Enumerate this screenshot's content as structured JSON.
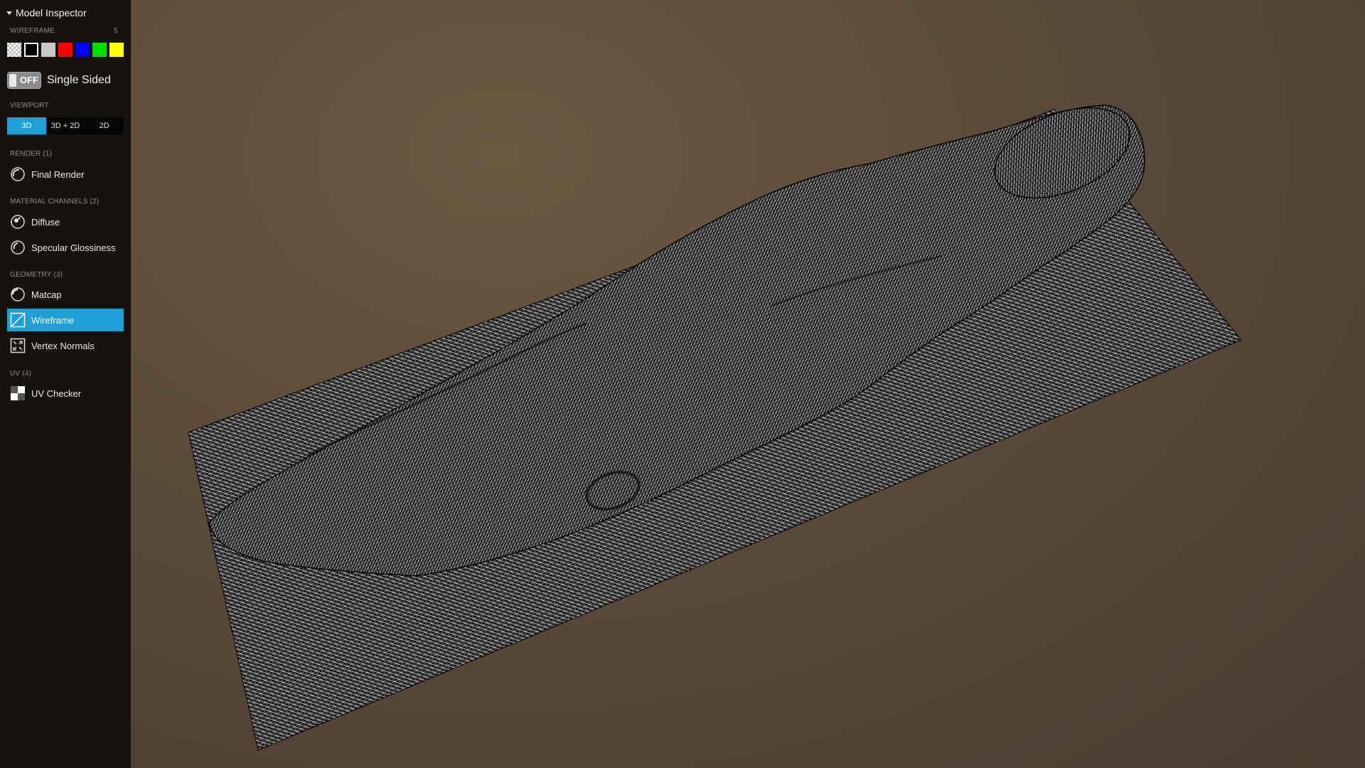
{
  "panel": {
    "title": "Model Inspector",
    "wireframe_label": "WIREFRAME",
    "wireframe_value": "5",
    "swatches": [
      {
        "name": "transparent",
        "color": "checker"
      },
      {
        "name": "black",
        "color": "#000000"
      },
      {
        "name": "gray",
        "color": "#c8c8c8"
      },
      {
        "name": "red",
        "color": "#ff0000"
      },
      {
        "name": "blue",
        "color": "#0000ff"
      },
      {
        "name": "green",
        "color": "#00e000"
      },
      {
        "name": "yellow",
        "color": "#ffff00"
      }
    ],
    "single_sided": {
      "state": "OFF",
      "label": "Single Sided"
    },
    "viewport_label": "VIEWPORT",
    "viewport_options": [
      "3D",
      "3D + 2D",
      "2D"
    ],
    "viewport_selected": "3D",
    "render_label": "RENDER (1)",
    "render_items": [
      "Final Render"
    ],
    "material_label": "MATERIAL CHANNELS (2)",
    "material_items": [
      "Diffuse",
      "Specular Glossiness"
    ],
    "geometry_label": "GEOMETRY (3)",
    "geometry_items": [
      "Matcap",
      "Wireframe",
      "Vertex Normals"
    ],
    "geometry_selected": "Wireframe",
    "uv_label": "UV (4)",
    "uv_items": [
      "UV Checker"
    ]
  },
  "colors": {
    "accent": "#1ea0d6",
    "sidebar_bg": "#16120e",
    "viewport_bg": "#5a4a38",
    "wire": "#ffffff"
  }
}
